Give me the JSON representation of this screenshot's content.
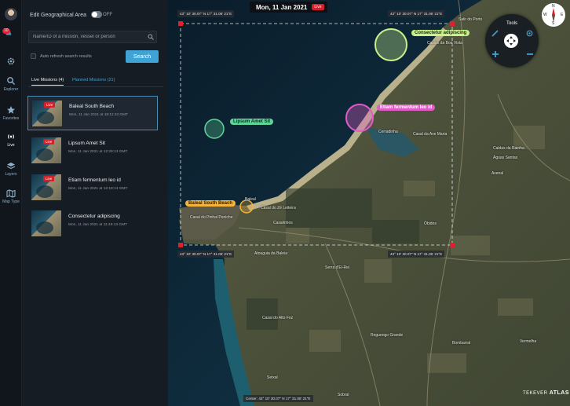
{
  "rail": {
    "explorer": "Explorer",
    "favorites": "Favorites",
    "live": "Live",
    "layers": "Layers",
    "map_type": "Map Type",
    "notification_count": "10"
  },
  "panel": {
    "edit_geo_label": "Edit Geographical Area",
    "toggle_state": "OFF",
    "search_placeholder": "Name/ID of a mission, vessel or person",
    "auto_refresh_label": "Auto refresh search results",
    "search_button": "Search",
    "tab_live": "Live Missions (4)",
    "tab_planned": "Planned Missions (21)"
  },
  "missions": [
    {
      "name": "Baleal South Beach",
      "time": "Mon, 11 Jan 2021 at 18:11:23 GMT",
      "badge": "Live"
    },
    {
      "name": "Lipsum Amet Sit",
      "time": "Mon, 11 Jan 2021 at 12:29:13 GMT",
      "badge": "Live"
    },
    {
      "name": "Etiam fermentum leo id",
      "time": "Mon, 11 Jan 2021 at 12:18:13 GMT",
      "badge": "Live"
    },
    {
      "name": "Consectetur adipiscing",
      "time": "Mon, 11 Jan 2021 at 11:49:13 GMT",
      "badge": "Live"
    }
  ],
  "map": {
    "date": "Mon, 11 Jan 2021",
    "live_badge": "Live",
    "coord_tl": "43° 10' 30.07\" N 17° 31.06' 21\"E",
    "coord_tr": "43° 10' 30.07\" N 17° 31.06' 21\"E",
    "coord_bl": "43° 10' 30.07\" N 17° 31.06' 21\"E",
    "coord_br": "43° 10' 30.07\" N 17° 31.06' 21\"E",
    "center_coord": "Center: 43° 10' 30.07\" N 17° 31.06' 21\"E",
    "tools_label": "Tools",
    "compass": {
      "n": "N",
      "s": "S",
      "e": "E",
      "w": "W"
    },
    "brand_prefix": "TEKEVER",
    "brand_name": "ATLAS",
    "markers": {
      "consectetur": "Consectetur adipiscing",
      "etiam": "Etiam fermentum leo id",
      "lipsum": "Lipsum Amet Sit",
      "baleal": "Baleal South Beach"
    },
    "places": {
      "p1": "Salir do Porto",
      "p2": "Casais da Boa Vista",
      "p3": "Cerradinha",
      "p4": "Casal da Ave Maria",
      "p5": "Caldas da Rainha",
      "p6": "Águas Santas",
      "p7": "Avenal",
      "p8": "Óbidos",
      "p9": "Casal do Zé Leiteira",
      "p10": "Casalinhos",
      "p11": "Casal do Pinhal Peniche",
      "p12": "Atouguia da Baleia",
      "p13": "Serra d'El-Rei",
      "p14": "Casal do Alto Foz",
      "p15": "Reguengo Grande",
      "p16": "Bombarral",
      "p17": "Vermelha",
      "p18": "Seixal",
      "p19": "Sobral",
      "p20": "Baleal"
    }
  },
  "colors": {
    "accent": "#3fa3d6",
    "live": "#d3202a",
    "marker_green": "#c9f08a",
    "marker_pink": "#e25cc8",
    "marker_teal": "#5fd49a",
    "marker_orange": "#f4b43c"
  }
}
